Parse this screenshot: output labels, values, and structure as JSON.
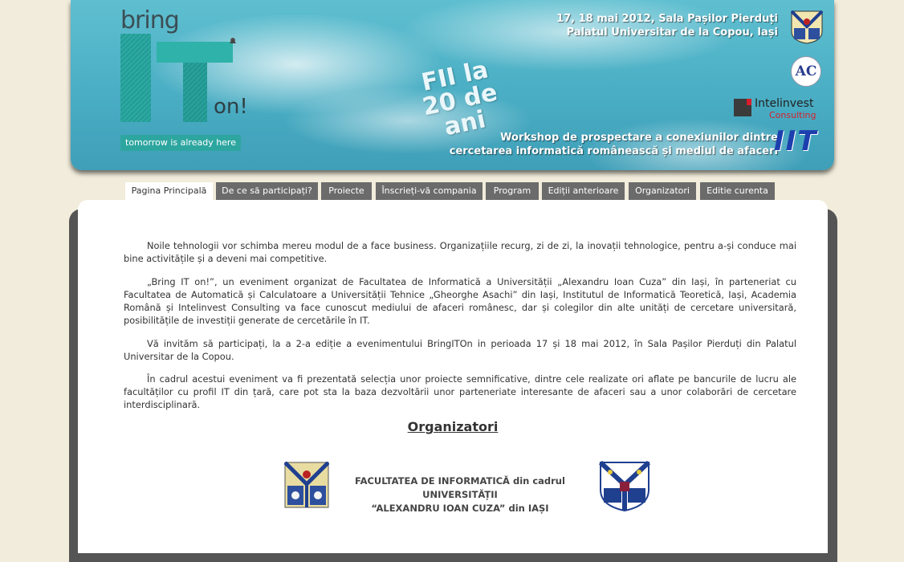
{
  "banner": {
    "bring": "bring",
    "it": "IT",
    "on": "on!",
    "tagline": "tomorrow is already here",
    "fii_line1": "FII la",
    "fii_line2": "20 de ani",
    "date_line": "17, 18 mai 2012, Sala Pașilor Pierduți",
    "venue_line": "Palatul Universitar de la Copou, Iași",
    "workshop_line1": "Workshop de prospectare a conexiunilor dintre",
    "workshop_line2": "cercetarea informatică românească și mediul de afaceri",
    "ac_logo": "AC",
    "intelinvest_name": "Intelinvest",
    "intelinvest_sub": "Consulting",
    "iit_logo": "IIT"
  },
  "nav": {
    "tabs": [
      {
        "label": "Pagina Principală",
        "active": true
      },
      {
        "label": "De ce să participați?"
      },
      {
        "label": "Proiecte"
      },
      {
        "label": "Înscrieți-vă compania"
      },
      {
        "label": "Program"
      },
      {
        "label": "Ediții anterioare"
      },
      {
        "label": "Organizatori"
      },
      {
        "label": "Editie curenta"
      }
    ]
  },
  "content": {
    "p1": "Noile tehnologii vor schimba mereu modul de a face business. Organizațiile recurg, zi de zi, la inovații tehnologice, pentru a-și conduce mai bine activitățile și a deveni mai competitive.",
    "p2": "„Bring IT on!”, un eveniment organizat de Facultatea de Informatică a Universității „Alexandru Ioan Cuza” din Iași, în parteneriat cu Facultatea de Automatică și Calculatoare a Universității Tehnice „Gheorghe Asachi” din Iași, Institutul de Informatică Teoretică, Iași, Academia Română și Intelinvest Consulting va face cunoscut mediului de afaceri românesc, dar și colegilor din alte unități de cercetare universitară, posibilitățile de investiții generate de cercetările în IT.",
    "p3": "Vă invităm să participați, la a 2-a ediție a evenimentului BringITOn in perioada 17 și 18 mai 2012, în Sala Pașilor Pierduți din Palatul Universitar de la Copou.",
    "p4": "În cadrul acestui eveniment va fi prezentată selecția unor proiecte semnificative, dintre cele realizate ori aflate pe bancurile de lucru ale facultăților cu profil IT din țară, care pot sta la baza dezvoltării unor parteneriate interesante de afaceri sau a unor colaborări de cercetare interdisciplinară.",
    "organizers_heading": "Organizatori",
    "faculty_line1": "FACULTATEA DE INFORMATICĂ din cadrul UNIVERSITĂȚII",
    "faculty_line2": "“ALEXANDRU IOAN CUZA” din IAȘI"
  },
  "colors": {
    "page_bg": "#f1ecdb",
    "tab_bg": "#6b6b6b",
    "tab_active_bg": "#ffffff",
    "banner_sky": "#4aaec4",
    "tagline_bg": "#2ea6a0"
  }
}
